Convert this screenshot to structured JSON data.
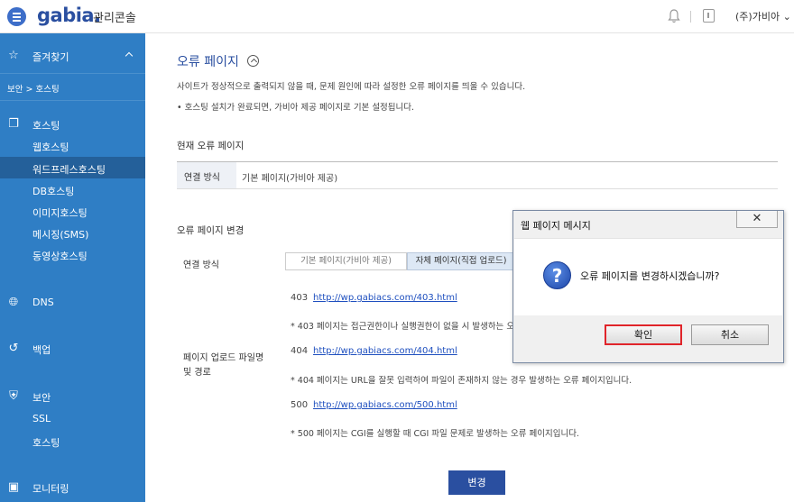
{
  "header": {
    "logo": "gabia.",
    "logo_sub": "관리콘솔",
    "user": "(주)가비아"
  },
  "sidebar": {
    "favorites": "즐겨찾기",
    "breadcrumb": "보안 > 호스팅",
    "hosting": "호스팅",
    "hosting_items": [
      "웹호스팅",
      "워드프레스호스팅",
      "DB호스팅",
      "이미지호스팅",
      "메시징(SMS)",
      "동영상호스팅"
    ],
    "dns": "DNS",
    "backup": "백업",
    "security": "보안",
    "security_items": [
      "SSL",
      "호스팅"
    ],
    "monitoring": "모니터링"
  },
  "main": {
    "title": "오류 페이지",
    "description": "사이트가 정상적으로 출력되지 않을 때, 문제 원인에 따라 설정한 오류 페이지를 띄울 수 있습니다.",
    "note": "•  호스팅 설치가 완료되면, 가비아 제공 페이지로 기본 설정됩니다.",
    "current_section": "현재 오류 페이지",
    "current_label": "연결 방식",
    "current_value": "기본 페이지(가비아 제공)",
    "change_section": "오류 페이지 변경",
    "change_label": "연결 방식",
    "option_default": "기본 페이지(가비아 제공)",
    "option_custom": "자체 페이지(직접 업로드)",
    "upload_label": "페이지 업로드 파일명 및 경로",
    "pages": [
      {
        "code": "403",
        "url": "http://wp.gabiacs.com/403.html",
        "hint": "* 403 페이지는 접근권한이나 실행권한이 없을 시 발생하는 오류 페이지입니다."
      },
      {
        "code": "404",
        "url": "http://wp.gabiacs.com/404.html",
        "hint": "* 404 페이지는 URL을 잘못 입력하여 파일이 존재하지 않는 경우 발생하는 오류 페이지입니다."
      },
      {
        "code": "500",
        "url": "http://wp.gabiacs.com/500.html",
        "hint": "* 500 페이지는 CGI를 실행할 때 CGI 파일 문제로 발생하는 오류 페이지입니다."
      }
    ],
    "submit": "변경"
  },
  "dialog": {
    "title": "웹 페이지 메시지",
    "close": "✕",
    "message": "오류 페이지를 변경하시겠습니까?",
    "ok": "확인",
    "cancel": "취소"
  }
}
